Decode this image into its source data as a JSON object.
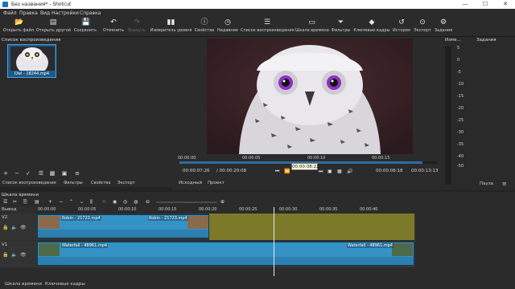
{
  "window": {
    "title": "Без названия* - Shotcut",
    "minimize": "—",
    "maximize": "☐",
    "close": "✕"
  },
  "menu": [
    {
      "label": "Файл"
    },
    {
      "label": "Правка"
    },
    {
      "label": "Вид"
    },
    {
      "label": "Настройки"
    },
    {
      "label": "Справка"
    }
  ],
  "toolbar": [
    {
      "label": "Открыть файл",
      "icon": "folder-icon",
      "glyph": "📂"
    },
    {
      "label": "Открыть другой",
      "icon": "open-other-icon",
      "glyph": "▤"
    },
    {
      "label": "Сохранить",
      "icon": "save-icon",
      "glyph": "💾"
    },
    {
      "label": "Отменить",
      "icon": "undo-icon",
      "glyph": "↶"
    },
    {
      "label": "Вернуть",
      "icon": "redo-icon",
      "glyph": "↷"
    },
    {
      "label": "Измеритель уровня",
      "icon": "level-meter-icon",
      "glyph": "▮▮"
    },
    {
      "label": "Свойства",
      "icon": "properties-icon",
      "glyph": "ⓘ"
    },
    {
      "label": "Недавние",
      "icon": "recent-icon",
      "glyph": "◷"
    },
    {
      "label": "Список воспроизведения",
      "icon": "playlist-icon",
      "glyph": "☰"
    },
    {
      "label": "Шкала времени",
      "icon": "timeline-icon",
      "glyph": "▭"
    },
    {
      "label": "Фильтры",
      "icon": "filter-icon",
      "glyph": "⏷"
    },
    {
      "label": "Ключевые кадры",
      "icon": "keyframes-icon",
      "glyph": "◆"
    },
    {
      "label": "История",
      "icon": "history-icon",
      "glyph": "↺"
    },
    {
      "label": "Экспорт",
      "icon": "export-icon",
      "glyph": "⊙"
    },
    {
      "label": "Задания",
      "icon": "jobs-icon",
      "glyph": "⚙"
    }
  ],
  "playlist": {
    "title": "Список воспроизведения",
    "item_caption": "Owl - 18244.mp4",
    "tabs": [
      "Список воспроизведения",
      "Фильтры",
      "Свойства",
      "Экспорт"
    ]
  },
  "viewer": {
    "ruler_labels": [
      "00:00:00",
      "00:00:05",
      "00:00:10",
      "00:00:15"
    ],
    "tooltip": "00:00:08:22",
    "position": "00:00:07:26",
    "duration": "/ 00:00:20:08",
    "in_point": "00:00:06:18",
    "selection": "00:00:13:13",
    "tabs": [
      "Исходный",
      "Проект"
    ],
    "progress": 0.94
  },
  "levels": {
    "title": "Изме...",
    "ticks": [
      "5",
      "0",
      "-5",
      "-10",
      "-15",
      "-20",
      "-25",
      "-30",
      "-35",
      "-40",
      "-50"
    ]
  },
  "tasks": {
    "title": "Задания",
    "pause_label": "Пауза"
  },
  "timeline": {
    "title": "Шкала времени",
    "output_label": "Вывод",
    "ruler_labels": [
      "00:00:00",
      "00:00:05",
      "00:00:10",
      "00:00:15",
      "00:00:20",
      "00:00:25",
      "00:00:30",
      "00:00:35",
      "00:00:40"
    ],
    "tracks": [
      {
        "name": "V2",
        "clips": [
          {
            "label": "Robin - 21723.mp4"
          },
          {
            "label": "Robin - 21723.mp4"
          }
        ]
      },
      {
        "name": "V1",
        "clips": [
          {
            "label": "Waterfall - 48961.mp4"
          },
          {
            "label": "Waterfall - 48961.mp4"
          }
        ]
      }
    ]
  },
  "bottom_tabs": [
    "Шкала времени",
    "Ключевые кадры"
  ]
}
